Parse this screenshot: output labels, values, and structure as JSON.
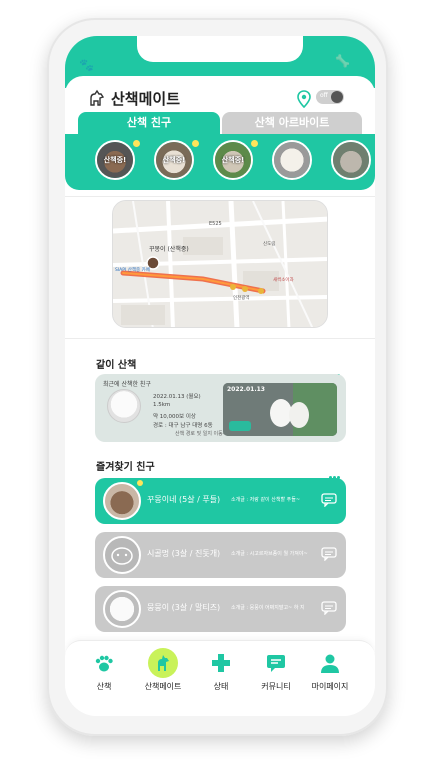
{
  "app": {
    "title": "산책메이트",
    "toggle_label": "off"
  },
  "tabs": [
    {
      "label": "산책 친구",
      "active": true
    },
    {
      "label": "산책 아르바이트",
      "active": false
    }
  ],
  "friends": [
    {
      "label": "산책중!",
      "online": true
    },
    {
      "label": "산책중!",
      "online": true
    },
    {
      "label": "산책중!",
      "online": true
    },
    {
      "label": "",
      "online": false
    },
    {
      "label": "",
      "online": false
    }
  ],
  "map": {
    "labels": [
      "E525",
      "꾸몽이 (산책중)",
      "SIAPI 산책중 카페",
      "인천광역",
      "새싹소아과",
      "신도림"
    ]
  },
  "together": {
    "title": "같이 산책",
    "recent_label": "최근에 산책한 친구",
    "date": "2022.01.13 (월요)",
    "distance": "1.5km",
    "steps": "약 10,000보 이상",
    "route": "경로 : 대구 남구 대명 6동",
    "link": "산책 경로 및 일지 이동하기",
    "photo_date": "2022.01.13"
  },
  "favorites": {
    "title": "즐겨찾기 친구",
    "items": [
      {
        "name": "꾸몽이네 (5살 / 푸들)",
        "intro": "소개글 : 저랑 같이 산책할 푸들~",
        "active": true
      },
      {
        "name": "시골멍 (3살 / 진돗개)",
        "intro": "소개글 : 시고르자브종이 뭘 가져야~",
        "active": false
      },
      {
        "name": "뭉뭉이 (3살 / 말티즈)",
        "intro": "소개글 : 뭉뭉이 어쩌지말고~ 하 지",
        "active": false
      }
    ]
  },
  "nav": [
    {
      "label": "산책",
      "icon": "paw-icon",
      "active": false
    },
    {
      "label": "산책메이트",
      "icon": "dog-icon",
      "active": true
    },
    {
      "label": "상태",
      "icon": "plus-icon",
      "active": false
    },
    {
      "label": "커뮤니티",
      "icon": "chat-icon",
      "active": false
    },
    {
      "label": "마이페이지",
      "icon": "person-icon",
      "active": false
    }
  ],
  "colors": {
    "primary": "#1fc7a3",
    "accent": "#c9f25a",
    "inactive": "#c9c9c9"
  }
}
